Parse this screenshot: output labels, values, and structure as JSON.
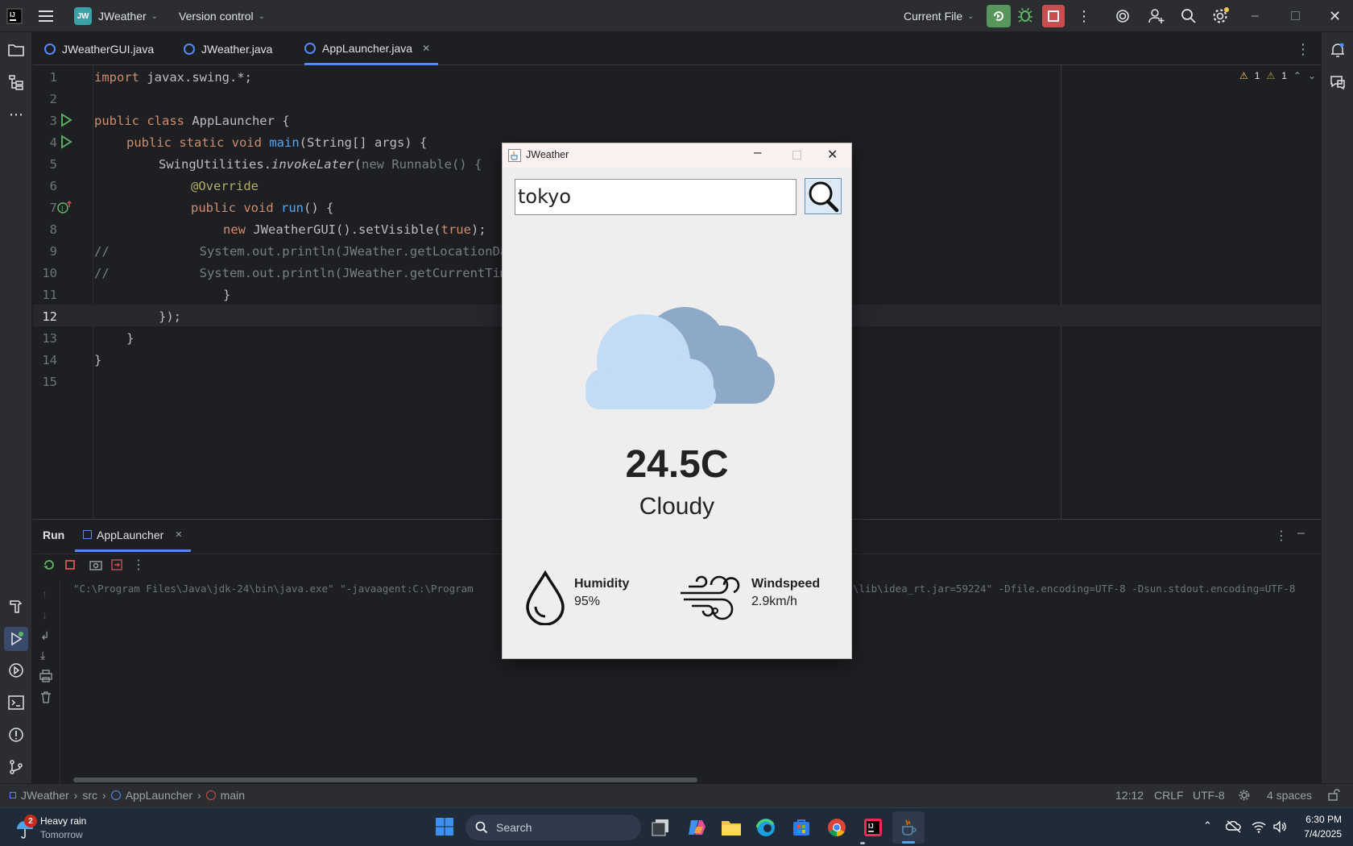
{
  "ide": {
    "logo_label": "IntelliJ",
    "project_badge": "JW",
    "project_name": "JWeather",
    "vcs_label": "Version control",
    "run_config": "Current File",
    "tabs": [
      {
        "label": "JWeatherGUI.java"
      },
      {
        "label": "JWeather.java"
      },
      {
        "label": "AppLauncher.java"
      }
    ],
    "inspections": {
      "warnings": "1",
      "weak_warnings": "1"
    },
    "code_lines": [
      {
        "n": "1"
      },
      {
        "n": "2"
      },
      {
        "n": "3"
      },
      {
        "n": "4"
      },
      {
        "n": "5"
      },
      {
        "n": "6"
      },
      {
        "n": "7"
      },
      {
        "n": "8"
      },
      {
        "n": "9"
      },
      {
        "n": "10"
      },
      {
        "n": "11"
      },
      {
        "n": "12"
      },
      {
        "n": "13"
      },
      {
        "n": "14"
      },
      {
        "n": "15"
      }
    ],
    "code": {
      "l1_kw": "import",
      "l1_rest": " javax.swing.*;",
      "l3_kw": "public class",
      "l3_rest": " AppLauncher {",
      "l4_kw": "public static void",
      "l4_fn": "main",
      "l4_rest": "(String[] args) {",
      "l5_a": "SwingUtilities.",
      "l5_fn": "invokeLater",
      "l5_b": "(",
      "l5_kw": "new",
      "l5_rest": " Runnable() {",
      "l6_an": "@Override",
      "l7_kw": "public void",
      "l7_fn": "run",
      "l7_rest": "() {",
      "l8_kw": "new",
      "l8_a": " JWeatherGUI().setVisible(",
      "l8_kw2": "true",
      "l8_rest": ");",
      "l9": "//            System.out.println(JWeather.getLocationData(\"Tokyo\"));",
      "l10": "//            System.out.println(JWeather.getCurrentTime());",
      "l11": "}",
      "l12": "});",
      "l13": "}",
      "l14": "}"
    },
    "run_panel": {
      "run_label": "Run",
      "tab_label": "AppLauncher",
      "console_left": "\"C:\\Program Files\\Java\\jdk-24\\bin\\java.exe\" \"-javaagent:C:\\Program",
      "console_right": "\\lib\\idea_rt.jar=59224\" -Dfile.encoding=UTF-8 -Dsun.stdout.encoding=UTF-8"
    },
    "status_bar": {
      "breadcrumb": [
        "JWeather",
        "src",
        "AppLauncher",
        "main"
      ],
      "position": "12:12",
      "line_sep": "CRLF",
      "encoding": "UTF-8",
      "indent": "4 spaces"
    }
  },
  "jweather": {
    "window_title": "JWeather",
    "search_value": "tokyo",
    "temperature": "24.5C",
    "condition": "Cloudy",
    "humidity_label": "Humidity",
    "humidity_value": "95%",
    "windspeed_label": "Windspeed",
    "windspeed_value": "2.9km/h"
  },
  "taskbar": {
    "weather_badge": "2",
    "weather_title": "Heavy rain",
    "weather_sub": "Tomorrow",
    "search_placeholder": "Search",
    "time": "6:30 PM",
    "date": "7/4/2025"
  },
  "colors": {
    "ide_bg": "#1e1f22",
    "ide_panel": "#2b2d30",
    "run_button": "#57965c",
    "stop_button": "#c94f4f",
    "accent": "#548af7"
  }
}
